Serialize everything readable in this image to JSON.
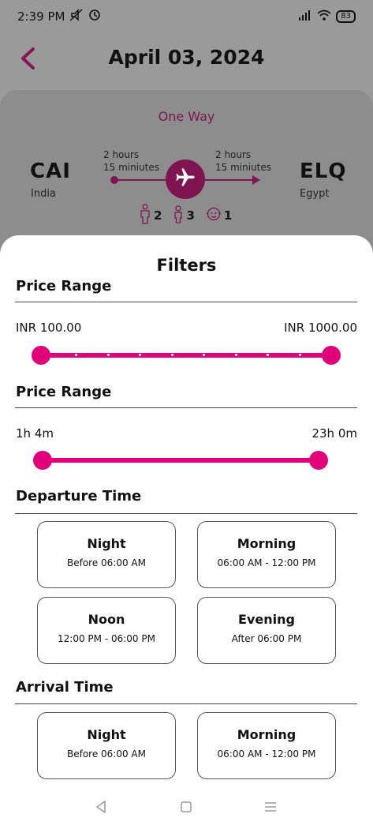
{
  "status_bar": {
    "time": "2:39 PM",
    "battery": "83",
    "icons": [
      "mute-icon",
      "alarm-icon",
      "signal-icon",
      "wifi-icon",
      "battery-icon"
    ]
  },
  "header": {
    "back_icon": "chevron-left-icon",
    "title": "April 03, 2024"
  },
  "flight": {
    "trip_type": "One Way",
    "origin": {
      "code": "CAI",
      "country": "India"
    },
    "destination": {
      "code": "ELQ",
      "country": "Egypt"
    },
    "duration_left": {
      "line1": "2 hours",
      "line2": "15 miniutes"
    },
    "duration_right": {
      "line1": "2 hours",
      "line2": "15 miniutes"
    },
    "plane_icon": "airplane-icon",
    "passengers": {
      "adults": "2",
      "children": "3",
      "infants": "1"
    }
  },
  "filters": {
    "title": "Filters",
    "price_range": {
      "title": "Price Range",
      "min_label": "INR 100.00",
      "max_label": "INR 1000.00",
      "low": 0,
      "high": 1
    },
    "duration_range": {
      "title": "Price Range",
      "min_label": "1h 4m",
      "max_label": "23h 0m",
      "low": 0,
      "high": 1
    },
    "departure": {
      "title": "Departure Time",
      "slots": [
        {
          "name": "Night",
          "range": "Before 06:00 AM"
        },
        {
          "name": "Morning",
          "range": "06:00 AM - 12:00 PM"
        },
        {
          "name": "Noon",
          "range": "12:00 PM - 06:00 PM"
        },
        {
          "name": "Evening",
          "range": "After 06:00 PM"
        }
      ]
    },
    "arrival": {
      "title": "Arrival Time",
      "slots": [
        {
          "name": "Night",
          "range": "Before 06:00 AM"
        },
        {
          "name": "Morning",
          "range": "06:00 AM - 12:00 PM"
        }
      ]
    }
  },
  "colors": {
    "accent": "#e0007a",
    "brand": "#7e1550"
  },
  "nav_bar": {
    "icons": [
      "back-triangle-icon",
      "home-square-icon",
      "menu-lines-icon"
    ]
  }
}
